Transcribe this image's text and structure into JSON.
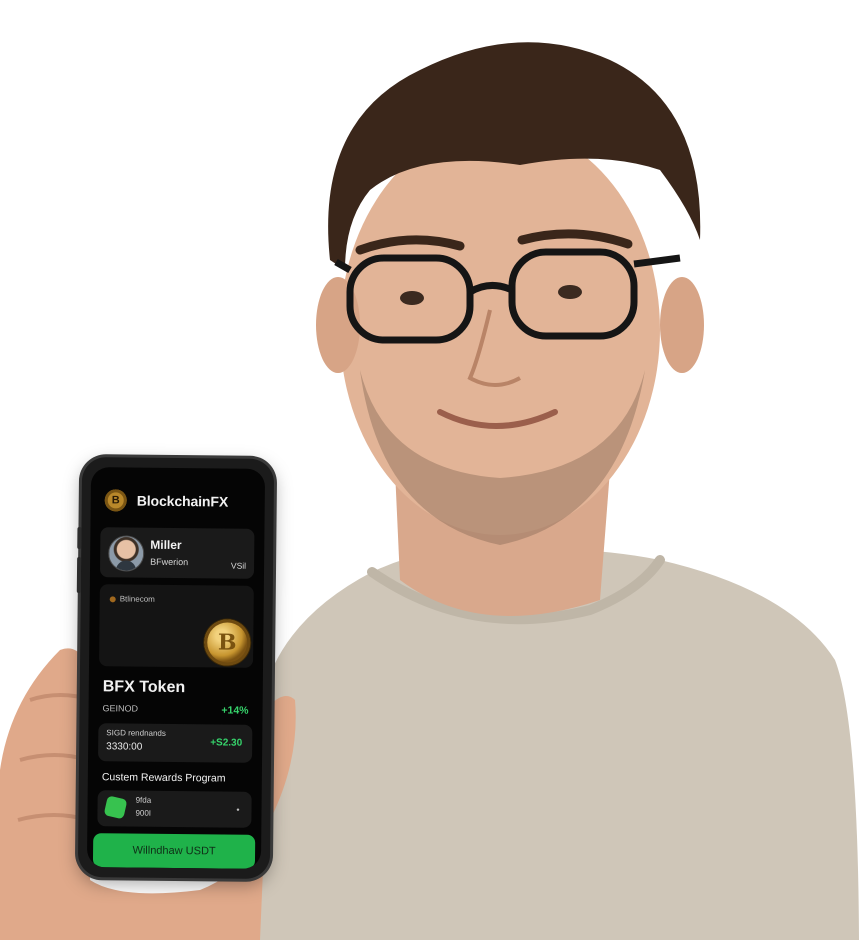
{
  "app": {
    "title": "BlockchainFX",
    "logo_icon": "coin-logo-icon",
    "logo_glyph": "B"
  },
  "profile": {
    "name": "Miller",
    "subtitle": "BFwerion",
    "tag": "VSil"
  },
  "coin_card": {
    "label": "Btlinecom",
    "coin_glyph": "B"
  },
  "token": {
    "name": "BFX Token",
    "subtitle": "GEINOD",
    "change": "+14%"
  },
  "rewards": {
    "label": "SIGD rendnands",
    "value": "3330:00",
    "change": "+S2.30"
  },
  "program": {
    "title": "Custem Rewards Program",
    "line1": "9fda",
    "line2": "900I",
    "dot": "•"
  },
  "withdraw_button": {
    "label": "Willndhaw USDT"
  },
  "colors": {
    "accent_green": "#1fb24a",
    "positive_text": "#36d36b",
    "screen_bg": "#050505",
    "coin_gold": "#c7952f",
    "shirt": "#cfc6b8"
  }
}
